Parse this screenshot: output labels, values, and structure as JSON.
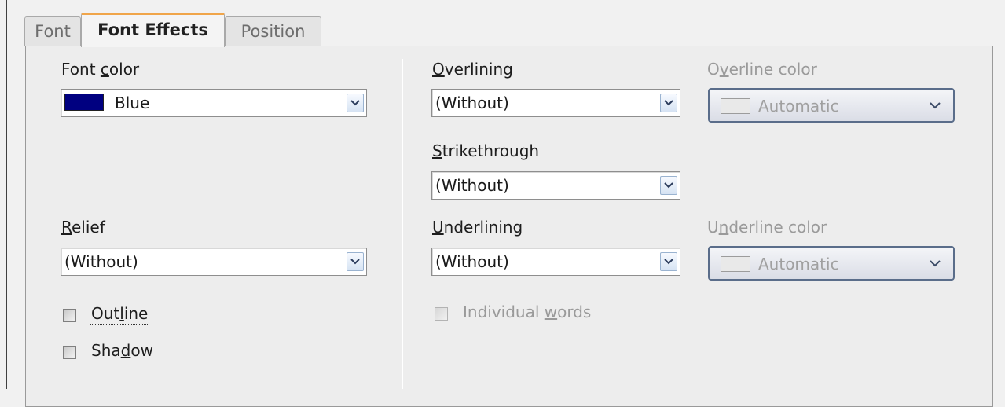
{
  "tabs": [
    {
      "label": "Font",
      "active": false
    },
    {
      "label": "Font Effects",
      "active": true
    },
    {
      "label": "Position",
      "active": false
    }
  ],
  "font_color": {
    "label_pre": "Font ",
    "label_key": "c",
    "label_post": "olor",
    "value": "Blue",
    "swatch": "#000080"
  },
  "relief": {
    "label_key": "R",
    "label_post": "elief",
    "value": "(Without)"
  },
  "outline": {
    "label_pre": "Out",
    "label_key": "l",
    "label_post": "ine",
    "checked": false
  },
  "shadow": {
    "label_pre": "Sha",
    "label_key": "d",
    "label_post": "ow",
    "checked": false
  },
  "overlining": {
    "label_key": "O",
    "label_post": "verlining",
    "value": "(Without)"
  },
  "overline_color": {
    "label_pre": "O",
    "label_key": "v",
    "label_post": "erline color",
    "value": "Automatic",
    "enabled": false
  },
  "strikethrough": {
    "label_key": "S",
    "label_post": "trikethrough",
    "value": "(Without)"
  },
  "underlining": {
    "label_key": "U",
    "label_post": "nderlining",
    "value": "(Without)"
  },
  "underline_color": {
    "label_pre": "U",
    "label_key": "n",
    "label_post": "derline color",
    "value": "Automatic",
    "enabled": false
  },
  "individual_words": {
    "label_pre": "Individual ",
    "label_key": "w",
    "label_post": "ords",
    "checked": false,
    "enabled": false
  },
  "colors": {
    "accent_tab": "#f0a54a",
    "disabled_text": "#9a9a9a"
  }
}
